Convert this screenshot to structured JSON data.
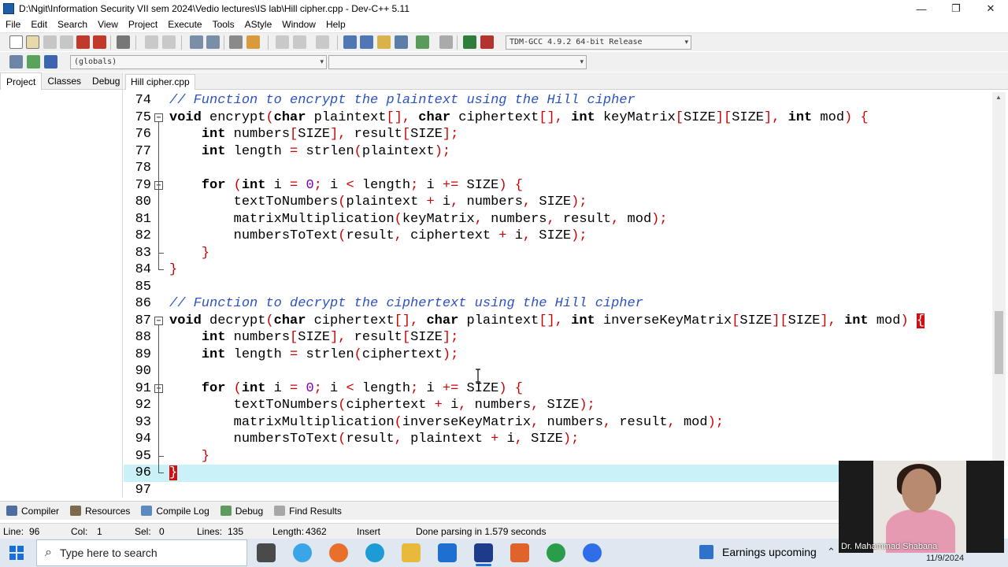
{
  "window": {
    "title": "D:\\Ngit\\Information Security VII sem 2024\\Vedio lectures\\IS lab\\Hill cipher.cpp - Dev-C++ 5.11",
    "buttons": {
      "minimize": "—",
      "maximize": "❐",
      "close": "✕"
    }
  },
  "menu": [
    "File",
    "Edit",
    "Search",
    "View",
    "Project",
    "Execute",
    "Tools",
    "AStyle",
    "Window",
    "Help"
  ],
  "toolbar": {
    "compiler_select": "TDM-GCC 4.9.2 64-bit Release",
    "scope_select": "(globals)",
    "symbol_select": ""
  },
  "left_panel": {
    "tabs": [
      "Project",
      "Classes",
      "Debug"
    ]
  },
  "editor": {
    "tab": "Hill cipher.cpp",
    "current_line": 96,
    "lines": [
      {
        "n": "74",
        "text": "// Function to encrypt the plaintext using the Hill cipher"
      },
      {
        "n": "75",
        "text": "void encrypt(char plaintext[], char ciphertext[], int keyMatrix[SIZE][SIZE], int mod) {"
      },
      {
        "n": "76",
        "text": "    int numbers[SIZE], result[SIZE];"
      },
      {
        "n": "77",
        "text": "    int length = strlen(plaintext);"
      },
      {
        "n": "78",
        "text": ""
      },
      {
        "n": "79",
        "text": "    for (int i = 0; i < length; i += SIZE) {"
      },
      {
        "n": "80",
        "text": "        textToNumbers(plaintext + i, numbers, SIZE);"
      },
      {
        "n": "81",
        "text": "        matrixMultiplication(keyMatrix, numbers, result, mod);"
      },
      {
        "n": "82",
        "text": "        numbersToText(result, ciphertext + i, SIZE);"
      },
      {
        "n": "83",
        "text": "    }"
      },
      {
        "n": "84",
        "text": "}"
      },
      {
        "n": "85",
        "text": ""
      },
      {
        "n": "86",
        "text": "// Function to decrypt the ciphertext using the Hill cipher"
      },
      {
        "n": "87",
        "text": "void decrypt(char ciphertext[], char plaintext[], int inverseKeyMatrix[SIZE][SIZE], int mod) {"
      },
      {
        "n": "88",
        "text": "    int numbers[SIZE], result[SIZE];"
      },
      {
        "n": "89",
        "text": "    int length = strlen(ciphertext);"
      },
      {
        "n": "90",
        "text": ""
      },
      {
        "n": "91",
        "text": "    for (int i = 0; i < length; i += SIZE) {"
      },
      {
        "n": "92",
        "text": "        textToNumbers(ciphertext + i, numbers, SIZE);"
      },
      {
        "n": "93",
        "text": "        matrixMultiplication(inverseKeyMatrix, numbers, result, mod);"
      },
      {
        "n": "94",
        "text": "        numbersToText(result, plaintext + i, SIZE);"
      },
      {
        "n": "95",
        "text": "    }"
      },
      {
        "n": "96",
        "text": "}"
      },
      {
        "n": "97",
        "text": ""
      }
    ]
  },
  "bottom_tabs": [
    "Compiler",
    "Resources",
    "Compile Log",
    "Debug",
    "Find Results"
  ],
  "status": {
    "line_label": "Line:",
    "line_value": "96",
    "col_label": "Col:",
    "col_value": "1",
    "sel_label": "Sel:",
    "sel_value": "0",
    "lines_label": "Lines:",
    "lines_value": "135",
    "length_label": "Length:",
    "length_value": "4362",
    "mode": "Insert",
    "message": "Done parsing in 1.579 seconds"
  },
  "taskbar": {
    "search_placeholder": "Type here to search",
    "weather": "Earnings upcoming",
    "date": "11/9/2024"
  },
  "webcam": {
    "caption": "Dr. Mahammad Shabana"
  },
  "colors": {
    "keyword": "#000000",
    "comment": "#2a52c4",
    "symbol": "#cc0000",
    "current_line": "#c9f1f7",
    "brace_match": "#d01010"
  }
}
